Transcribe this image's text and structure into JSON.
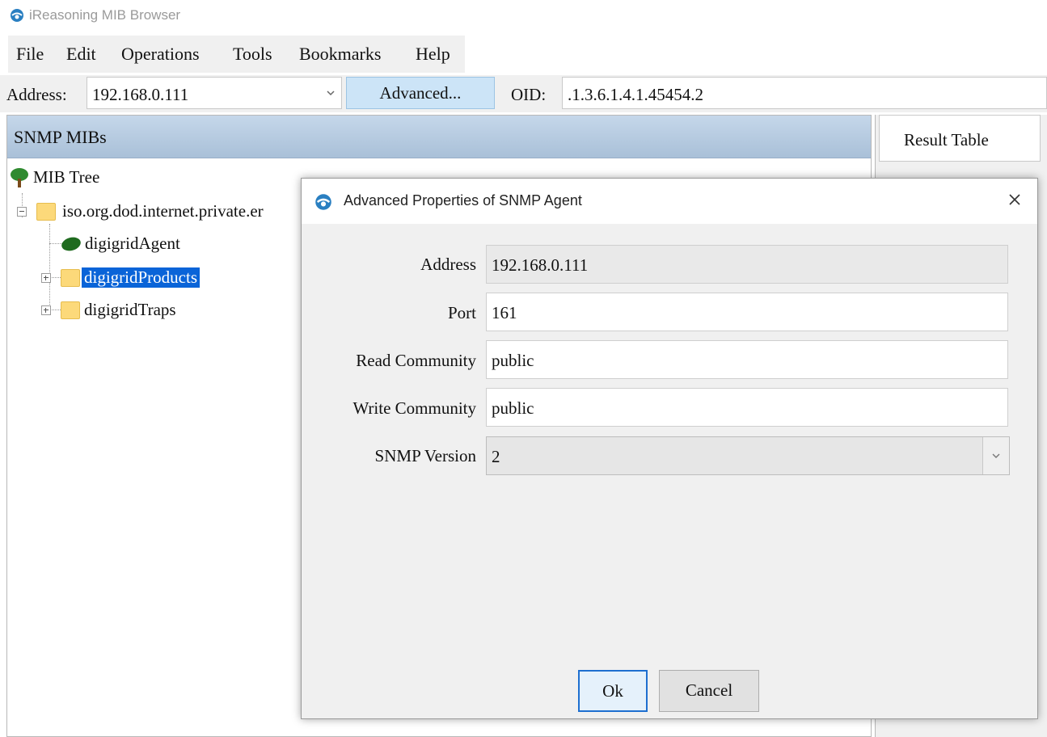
{
  "window": {
    "title": "iReasoning MIB Browser",
    "app_icon": "globe-icon"
  },
  "menu": [
    "File",
    "Edit",
    "Operations",
    "Tools",
    "Bookmarks",
    "Help"
  ],
  "toolbar": {
    "address_label": "Address:",
    "address_value": "192.168.0.111",
    "advanced_label": "Advanced...",
    "oid_label": "OID:",
    "oid_value": ".1.3.6.1.4.1.45454.2"
  },
  "left_panel": {
    "header": "SNMP MIBs",
    "tree": {
      "root": "MIB Tree",
      "node": "iso.org.dod.internet.private.er",
      "children": [
        "digigridAgent",
        "digigridProducts",
        "digigridTraps"
      ],
      "selected": "digigridProducts"
    }
  },
  "right_panel": {
    "tab": "Result Table"
  },
  "dialog": {
    "title": "Advanced Properties of SNMP Agent",
    "fields": {
      "address_label": "Address",
      "address_value": "192.168.0.111",
      "port_label": "Port",
      "port_value": "161",
      "read_label": "Read Community",
      "read_value": "public",
      "write_label": "Write Community",
      "write_value": "public",
      "version_label": "SNMP Version",
      "version_value": "2"
    },
    "ok_label": "Ok",
    "cancel_label": "Cancel"
  },
  "colors": {
    "selection": "#0a64d8",
    "header_bar": "#b4c9df",
    "advanced_button": "#cce4f7"
  }
}
